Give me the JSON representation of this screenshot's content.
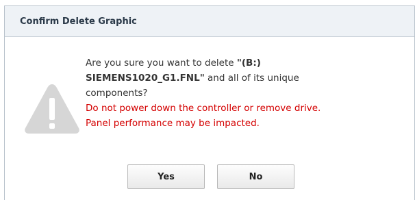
{
  "dialog": {
    "title": "Confirm Delete Graphic",
    "icon": "warning-triangle-icon",
    "message": {
      "line1_prefix": "Are you sure you want to delete ",
      "filename_part1": "\"(B:)",
      "filename_part2": "SIEMENS1020_G1.FNL\"",
      "line2_suffix": " and all of its unique",
      "line3": "components?",
      "warning1": "Do not power down the controller or remove drive.",
      "warning2": "Panel performance may be impacted."
    },
    "buttons": {
      "yes_label": "Yes",
      "no_label": "No"
    }
  },
  "colors": {
    "title_bar_bg": "#eef2f6",
    "warning_text": "#d40000",
    "icon_gray": "#d6d6d6"
  }
}
